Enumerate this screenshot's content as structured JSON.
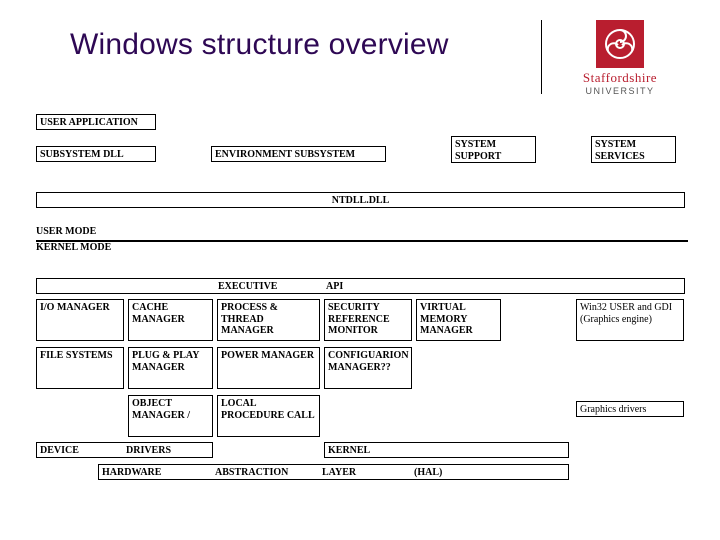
{
  "header": {
    "title": "Windows structure overview",
    "logo_line1": "Staffordshire",
    "logo_line2": "UNIVERSITY"
  },
  "boxes": {
    "user_app": "USER APPLICATION",
    "subsystem_dll": "SUBSYSTEM DLL",
    "env_subsystem": "ENVIRONMENT SUBSYSTEM",
    "system_support": "SYSTEM SUPPORT",
    "system_services": "SYSTEM SERVICES",
    "ntdll": "NTDLL.DLL",
    "user_mode": "USER MODE",
    "kernel_mode": "KERNEL MODE",
    "executive": "EXECUTIVE",
    "api": "API",
    "io_mgr": "I/O MANAGER",
    "cache_mgr": "CACHE MANAGER",
    "proc_thread_mgr": "PROCESS & THREAD MANAGER",
    "sec_ref_mon": "SECURITY REFERENCE MONITOR",
    "vmm": "VIRTUAL MEMORY MANAGER",
    "win32_gdi": "Win32 USER and GDI (Graphics engine)",
    "file_systems": "FILE SYSTEMS",
    "pnp_mgr": "PLUG & PLAY MANAGER",
    "power_mgr": "POWER MANAGER",
    "config_mgr": "CONFIGUARION MANAGER??",
    "obj_mgr": "OBJECT MANAGER /",
    "lpc": "LOCAL PROCEDURE CALL",
    "gfx_drivers": "Graphics drivers",
    "device": "DEVICE",
    "drivers": "DRIVERS",
    "kernel": "KERNEL",
    "hardware": "HARDWARE",
    "abstraction": "ABSTRACTION",
    "layer": "LAYER",
    "hal": "(HAL)"
  }
}
